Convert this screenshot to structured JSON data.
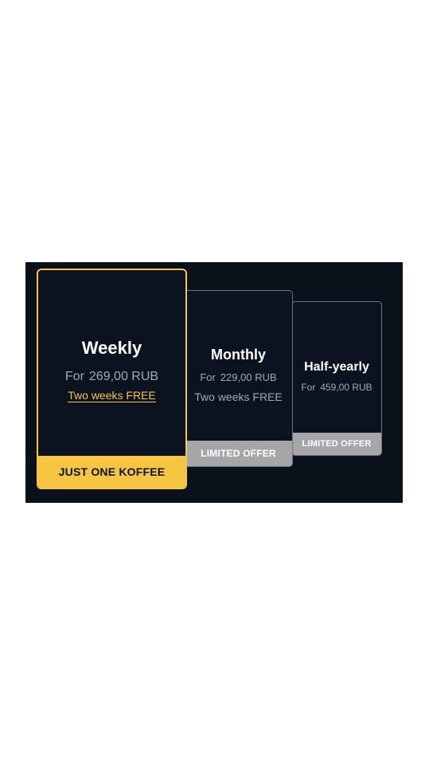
{
  "plans": [
    {
      "id": "weekly",
      "title": "Weekly",
      "for_label": "For",
      "price": "269,00 RUB",
      "bonus": "Two weeks FREE",
      "footer": "JUST ONE KOFFEE",
      "selected": true
    },
    {
      "id": "monthly",
      "title": "Monthly",
      "for_label": "For",
      "price": "229,00 RUB",
      "bonus": "Two weeks FREE",
      "footer": "LIMITED OFFER",
      "selected": false
    },
    {
      "id": "half-yearly",
      "title": "Half-yearly",
      "for_label": "For",
      "price": "459,00 RUB",
      "footer": "LIMITED OFFER",
      "selected": false
    }
  ],
  "colors": {
    "panel_background": "#0b111b",
    "card_background": "#0b1220",
    "accent": "#f6c544",
    "muted_footer": "#a6a6a8",
    "muted_text": "#a4a9b1"
  }
}
